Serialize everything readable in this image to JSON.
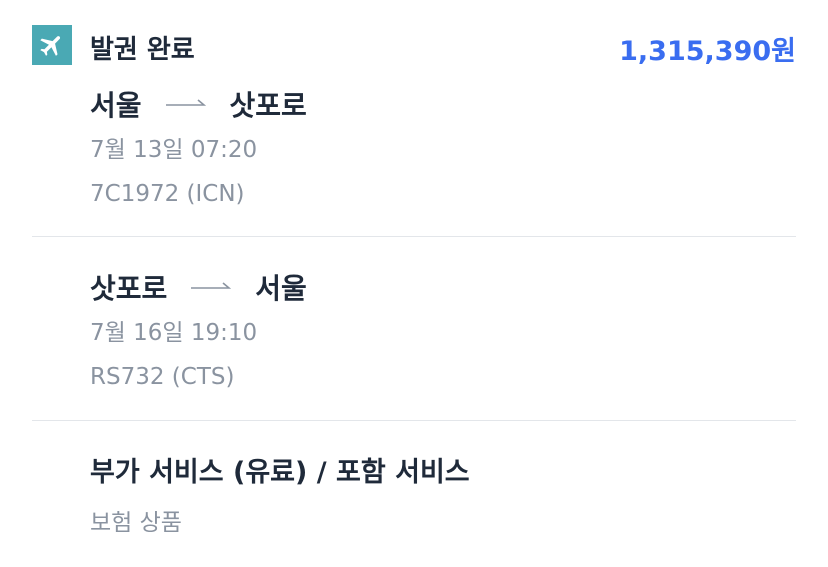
{
  "header": {
    "status_label": "발권 완료",
    "price": "1,315,390원",
    "icon": "airplane-icon"
  },
  "segments": [
    {
      "from": "서울",
      "to": "삿포로",
      "datetime": "7월 13일 07:20",
      "flight": "7C1972 (ICN)"
    },
    {
      "from": "삿포로",
      "to": "서울",
      "datetime": "7월 16일 19:10",
      "flight": "RS732 (CTS)"
    }
  ],
  "services": {
    "title": "부가 서비스 (유료) / 포함 서비스",
    "items": [
      "보험 상품"
    ]
  },
  "colors": {
    "accent": "#3a6df0",
    "icon_bg": "#4aa9b4",
    "muted_text": "#8a93a0",
    "divider": "#e3e6ea"
  }
}
